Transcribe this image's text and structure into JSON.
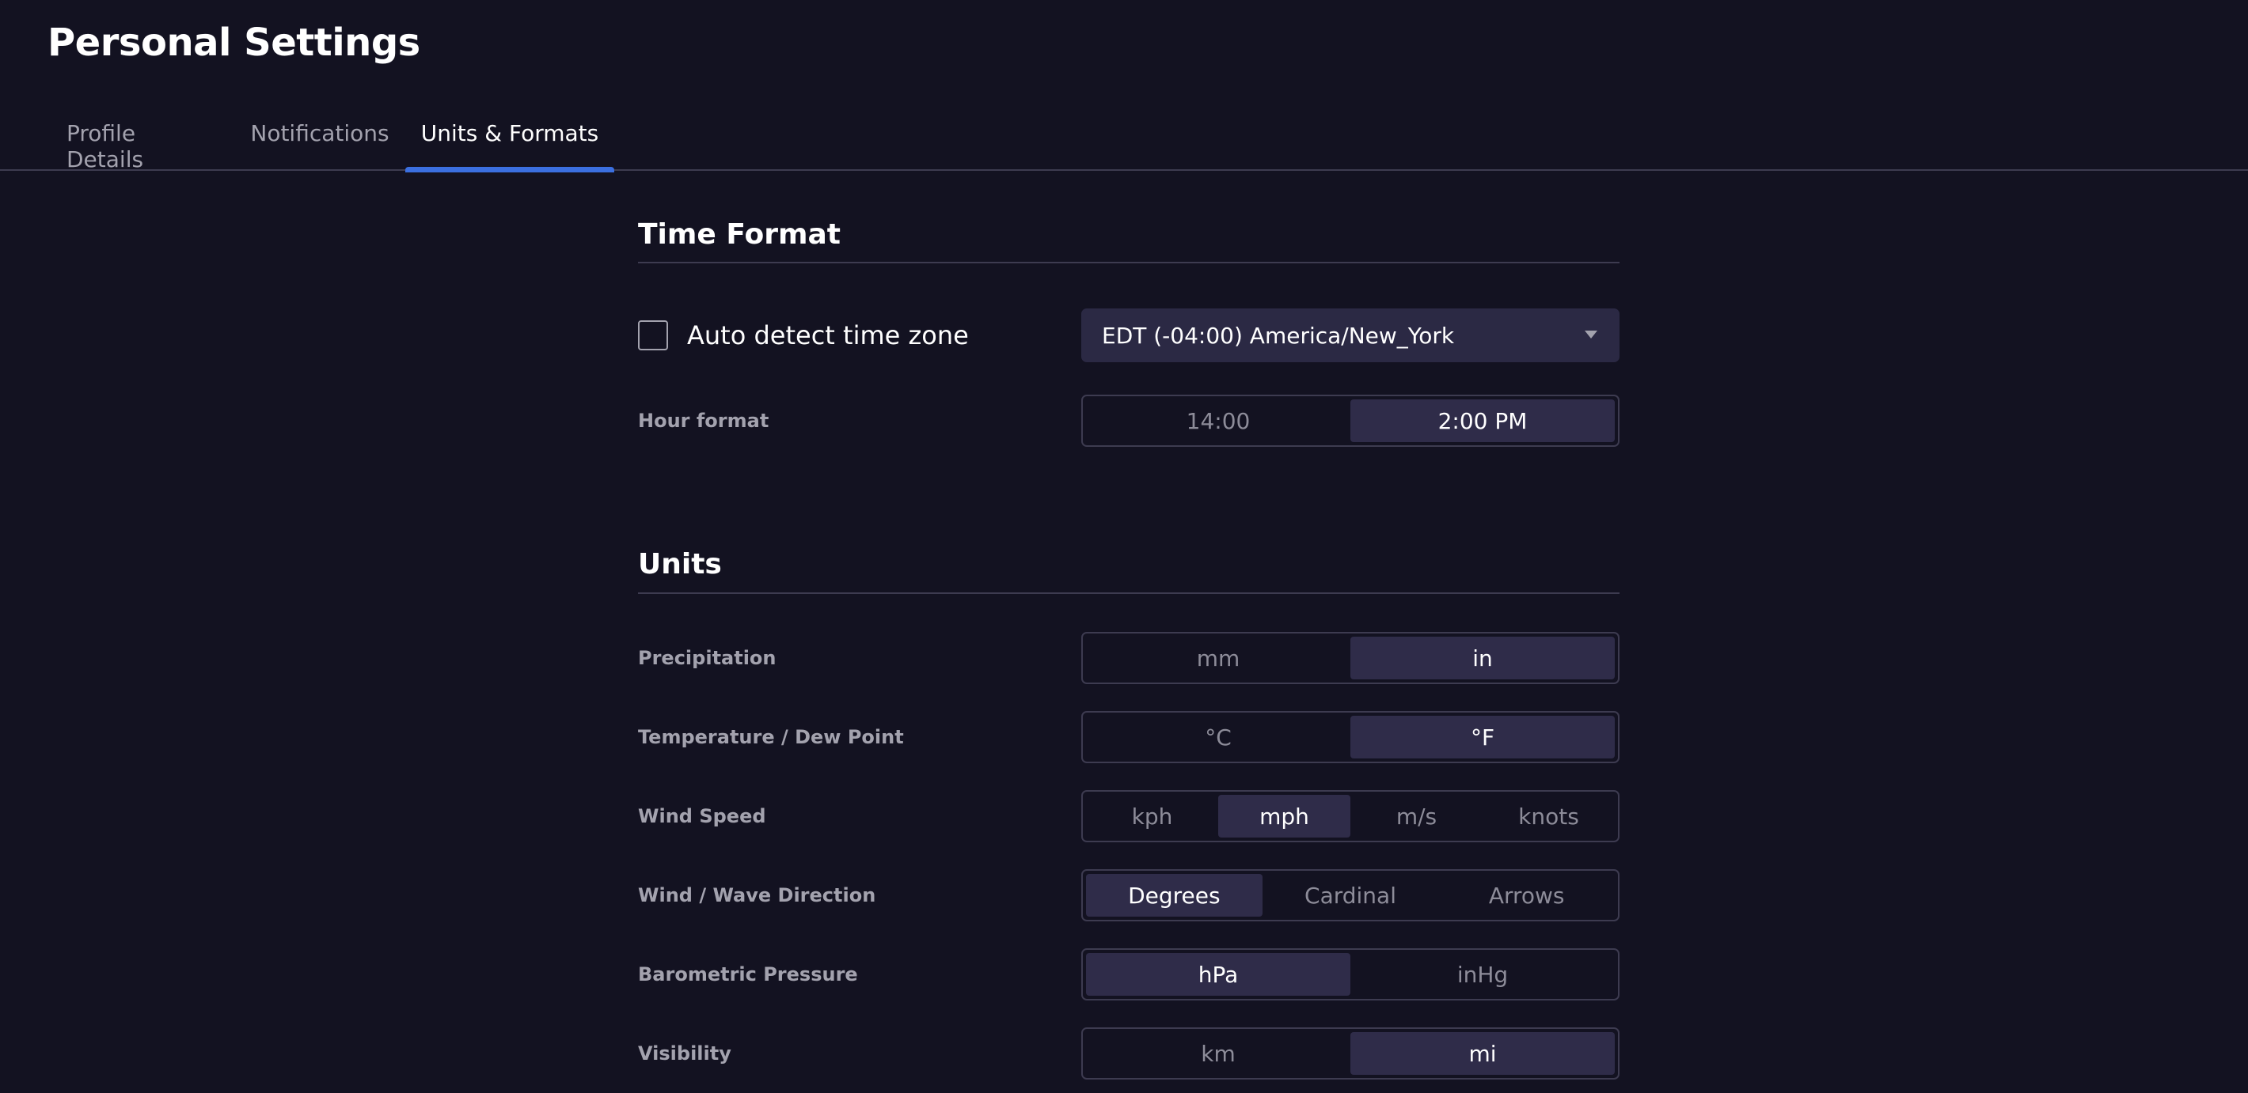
{
  "page_title": "Personal Settings",
  "tabs": [
    {
      "label": "Profile Details",
      "active": false
    },
    {
      "label": "Notifications",
      "active": false
    },
    {
      "label": "Units & Formats",
      "active": true
    }
  ],
  "time_format": {
    "title": "Time Format",
    "auto_detect_label": "Auto detect time zone",
    "auto_detect_checked": false,
    "timezone_value": "EDT (-04:00) America/New_York",
    "hour_format": {
      "label": "Hour format",
      "options": [
        "14:00",
        "2:00 PM"
      ],
      "selected": "2:00 PM"
    }
  },
  "units": {
    "title": "Units",
    "rows": [
      {
        "label": "Precipitation",
        "options": [
          "mm",
          "in"
        ],
        "selected": "in"
      },
      {
        "label": "Temperature / Dew Point",
        "options": [
          "°C",
          "°F"
        ],
        "selected": "°F"
      },
      {
        "label": "Wind Speed",
        "options": [
          "kph",
          "mph",
          "m/s",
          "knots"
        ],
        "selected": "mph"
      },
      {
        "label": "Wind / Wave Direction",
        "options": [
          "Degrees",
          "Cardinal",
          "Arrows"
        ],
        "selected": "Degrees"
      },
      {
        "label": "Barometric Pressure",
        "options": [
          "hPa",
          "inHg"
        ],
        "selected": "hPa"
      },
      {
        "label": "Visibility",
        "options": [
          "km",
          "mi"
        ],
        "selected": "mi"
      }
    ]
  },
  "colors": {
    "background": "#131221",
    "accent": "#3b6fe0",
    "selected_segment": "#2f2c49"
  }
}
